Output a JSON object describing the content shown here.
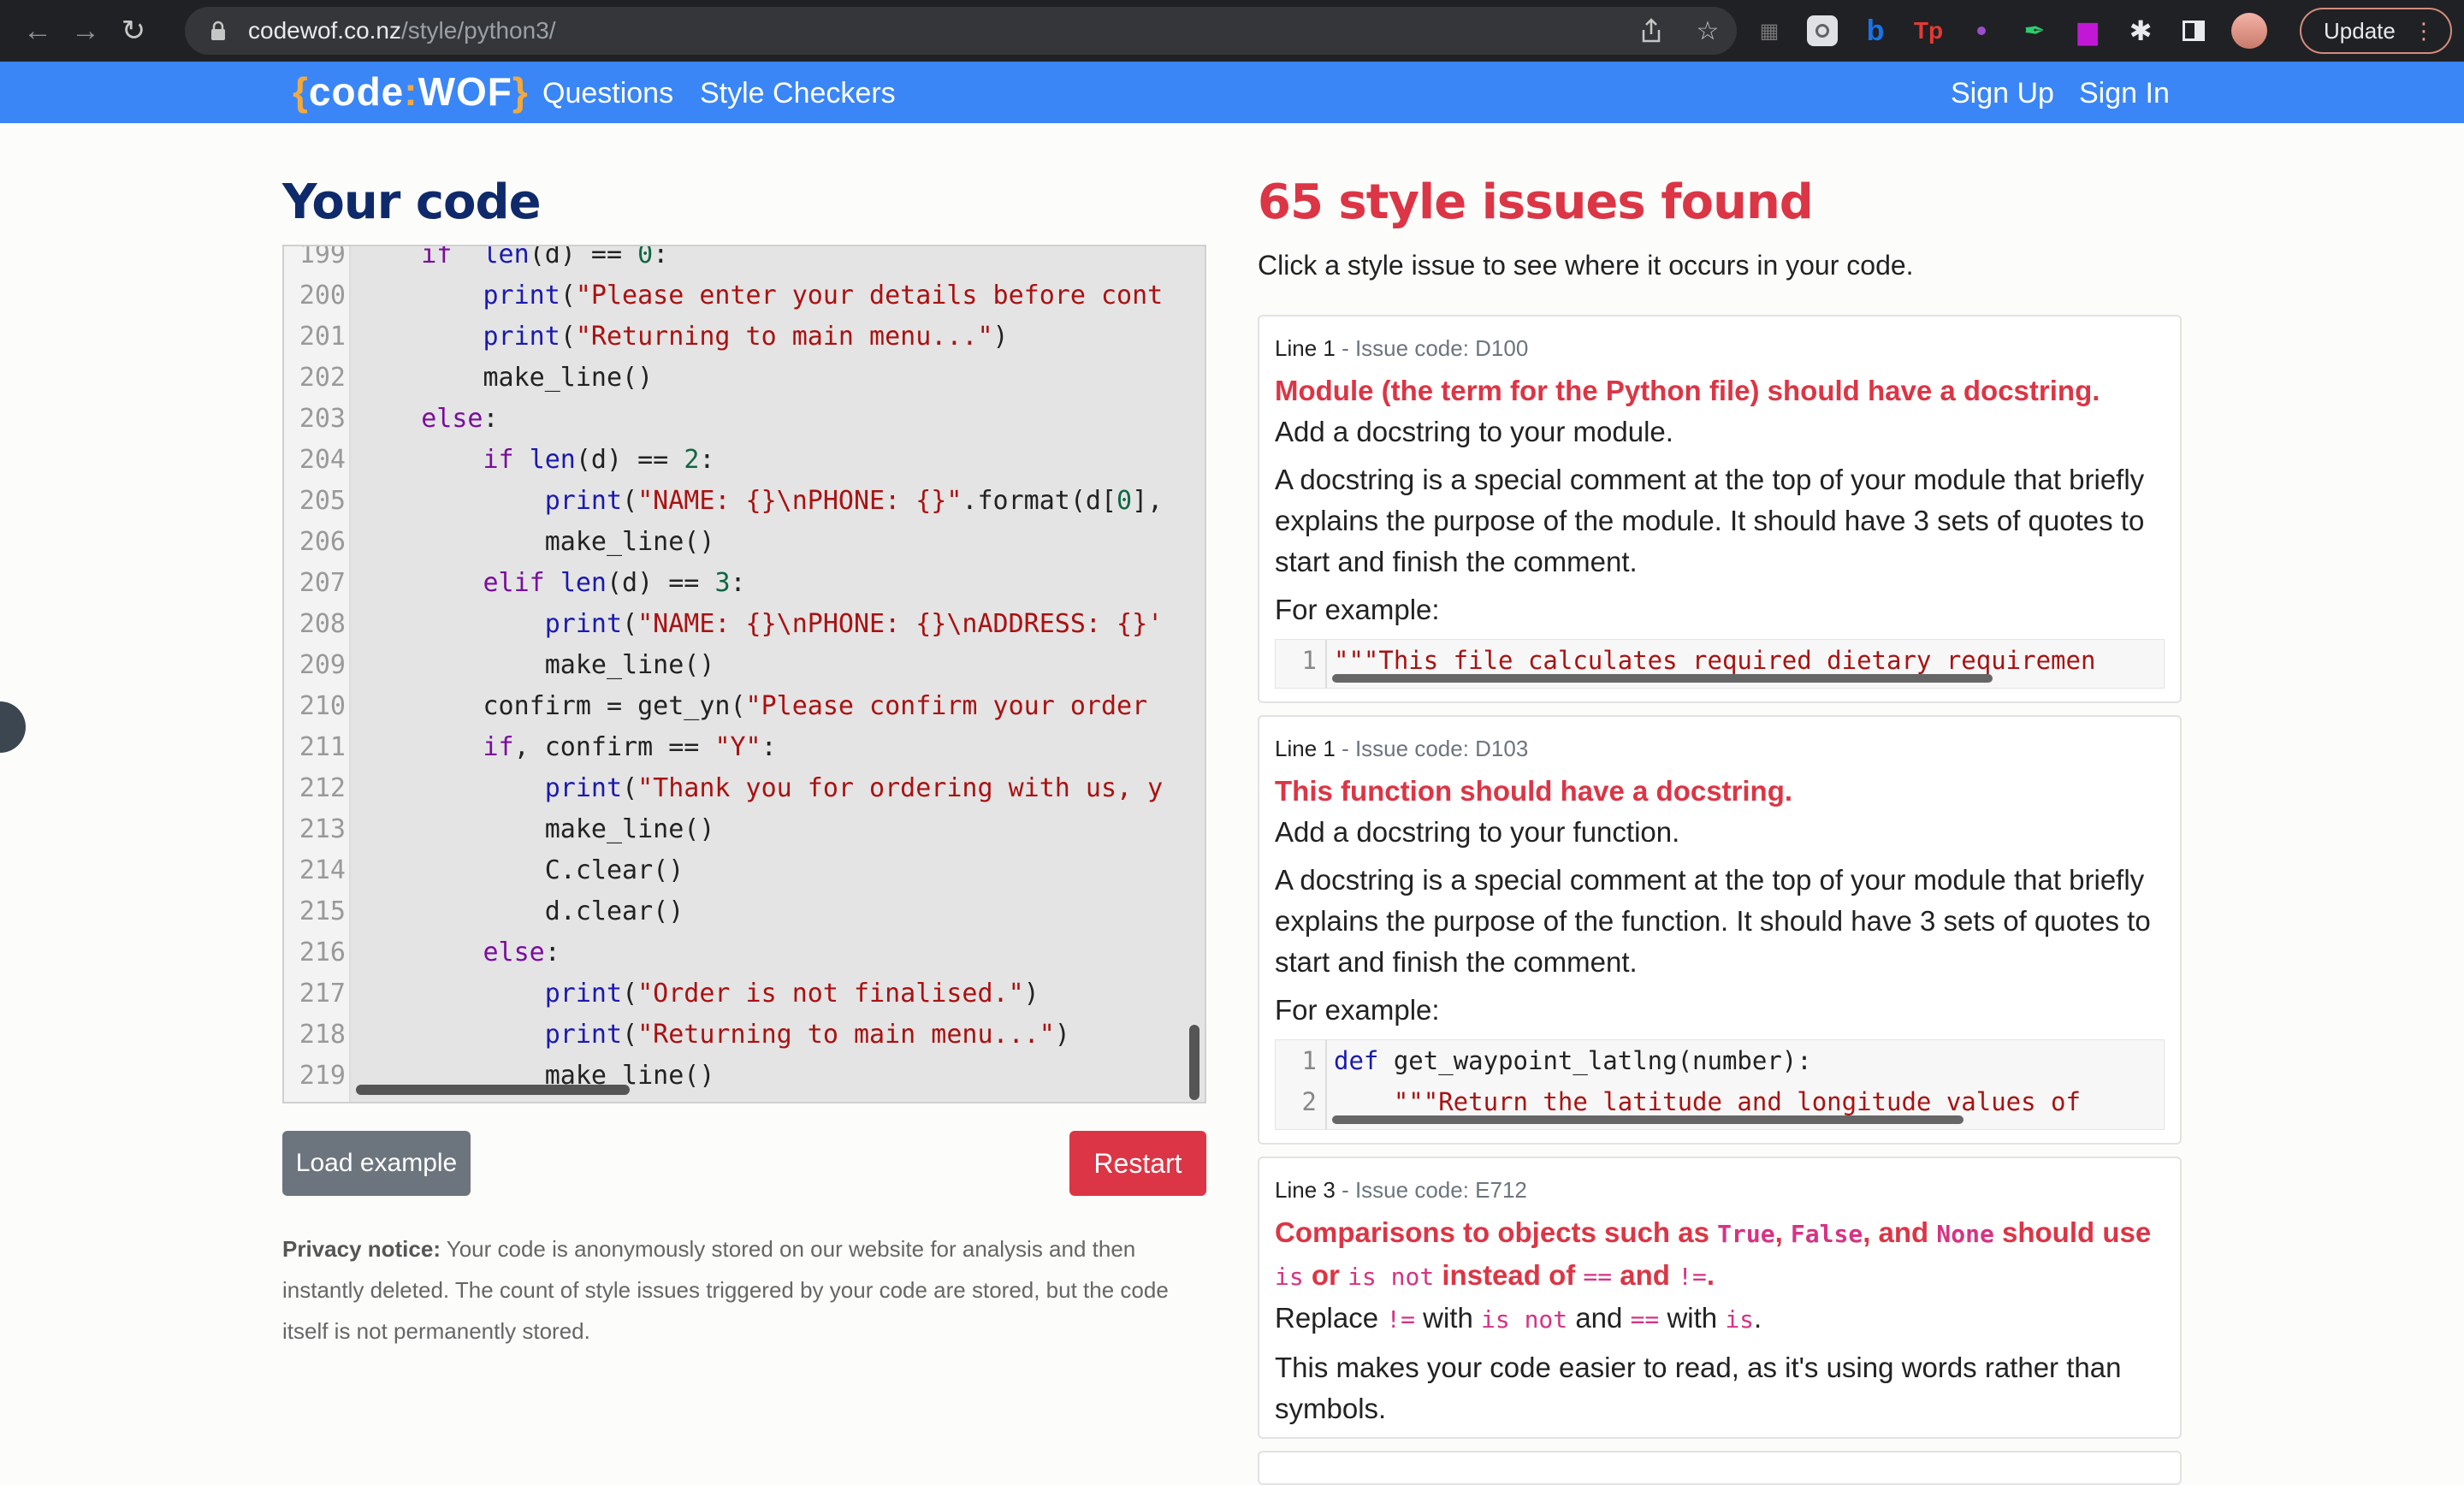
{
  "browser": {
    "url_host": "codewof.co.nz",
    "url_path": "/style/python3/",
    "update_label": "Update"
  },
  "nav": {
    "logo_open": "{",
    "logo_code": "code",
    "logo_colon": ":",
    "logo_wof": "WOF",
    "logo_close": "}",
    "questions": "Questions",
    "style_checkers": "Style Checkers",
    "sign_up": "Sign Up",
    "sign_in": "Sign In"
  },
  "left": {
    "heading": "Your code",
    "load_example": "Load example",
    "restart": "Restart",
    "privacy_label": "Privacy notice:",
    "privacy_text": " Your code is anonymously stored on our website for analysis and then instantly deleted. The count of style issues triggered by your code are stored, but the code itself is not permanently stored."
  },
  "editor": {
    "lines": [
      {
        "n": "199",
        "indent": "    ",
        "parts": [
          [
            "kw",
            "if"
          ],
          [
            "",
            "  "
          ],
          [
            "bi",
            "len"
          ],
          [
            "",
            "(d) == "
          ],
          [
            "num",
            "0"
          ],
          [
            "",
            ":"
          ]
        ]
      },
      {
        "n": "200",
        "indent": "        ",
        "parts": [
          [
            "bi",
            "print"
          ],
          [
            "",
            "("
          ],
          [
            "str",
            "\"Please enter your details before cont"
          ]
        ]
      },
      {
        "n": "201",
        "indent": "        ",
        "parts": [
          [
            "bi",
            "print"
          ],
          [
            "",
            "("
          ],
          [
            "str",
            "\"Returning to main menu...\""
          ],
          [
            "",
            ")"
          ]
        ]
      },
      {
        "n": "202",
        "indent": "        ",
        "parts": [
          [
            "",
            "make_line()"
          ]
        ]
      },
      {
        "n": "203",
        "indent": "    ",
        "parts": [
          [
            "kw",
            "else"
          ],
          [
            "",
            ":"
          ]
        ]
      },
      {
        "n": "204",
        "indent": "        ",
        "parts": [
          [
            "kw",
            "if"
          ],
          [
            "",
            " "
          ],
          [
            "bi",
            "len"
          ],
          [
            "",
            "(d) == "
          ],
          [
            "num",
            "2"
          ],
          [
            "",
            ":"
          ]
        ]
      },
      {
        "n": "205",
        "indent": "            ",
        "parts": [
          [
            "bi",
            "print"
          ],
          [
            "",
            "("
          ],
          [
            "str",
            "\"NAME: {}\\nPHONE: {}\""
          ],
          [
            "",
            ".format(d["
          ],
          [
            "num",
            "0"
          ],
          [
            "",
            "],"
          ]
        ]
      },
      {
        "n": "206",
        "indent": "            ",
        "parts": [
          [
            "",
            "make_line()"
          ]
        ]
      },
      {
        "n": "207",
        "indent": "        ",
        "parts": [
          [
            "kw",
            "elif"
          ],
          [
            "",
            " "
          ],
          [
            "bi",
            "len"
          ],
          [
            "",
            "(d) == "
          ],
          [
            "num",
            "3"
          ],
          [
            "",
            ":"
          ]
        ]
      },
      {
        "n": "208",
        "indent": "            ",
        "parts": [
          [
            "bi",
            "print"
          ],
          [
            "",
            "("
          ],
          [
            "str",
            "\"NAME: {}\\nPHONE: {}\\nADDRESS: {}'"
          ]
        ]
      },
      {
        "n": "209",
        "indent": "            ",
        "parts": [
          [
            "",
            "make_line()"
          ]
        ]
      },
      {
        "n": "210",
        "indent": "        ",
        "parts": [
          [
            "",
            "confirm = get_yn("
          ],
          [
            "str",
            "\"Please confirm your order"
          ]
        ]
      },
      {
        "n": "211",
        "indent": "        ",
        "parts": [
          [
            "kw",
            "if"
          ],
          [
            "",
            ", confirm == "
          ],
          [
            "str",
            "\"Y\""
          ],
          [
            "",
            ":"
          ]
        ]
      },
      {
        "n": "212",
        "indent": "            ",
        "parts": [
          [
            "bi",
            "print"
          ],
          [
            "",
            "("
          ],
          [
            "str",
            "\"Thank you for ordering with us, y"
          ]
        ]
      },
      {
        "n": "213",
        "indent": "            ",
        "parts": [
          [
            "",
            "make_line()"
          ]
        ]
      },
      {
        "n": "214",
        "indent": "            ",
        "parts": [
          [
            "",
            "C.clear()"
          ]
        ]
      },
      {
        "n": "215",
        "indent": "            ",
        "parts": [
          [
            "",
            "d.clear()"
          ]
        ]
      },
      {
        "n": "216",
        "indent": "        ",
        "parts": [
          [
            "kw",
            "else"
          ],
          [
            "",
            ":"
          ]
        ]
      },
      {
        "n": "217",
        "indent": "            ",
        "parts": [
          [
            "bi",
            "print"
          ],
          [
            "",
            "("
          ],
          [
            "str",
            "\"Order is not finalised.\""
          ],
          [
            "",
            ")"
          ]
        ]
      },
      {
        "n": "218",
        "indent": "            ",
        "parts": [
          [
            "bi",
            "print"
          ],
          [
            "",
            "("
          ],
          [
            "str",
            "\"Returning to main menu...\""
          ],
          [
            "",
            ")"
          ]
        ]
      },
      {
        "n": "219",
        "indent": "            ",
        "parts": [
          [
            "",
            "make_line()"
          ]
        ]
      }
    ]
  },
  "right": {
    "heading": "65 style issues found",
    "subtext": "Click a style issue to see where it occurs in your code."
  },
  "issues": [
    {
      "line_label": "Line 1",
      "issue_code": " - Issue code: D100",
      "title": "Module (the term for the Python file) should have a docstring.",
      "fix": "Add a docstring to your module.",
      "explanation": "A docstring is a special comment at the top of your module that briefly explains the purpose of the module. It should have 3 sets of quotes to start and finish the comment.",
      "example_label": "For example:",
      "snippet": [
        {
          "n": "1",
          "code": "\"\"\"This file calculates required dietary requiremen"
        }
      ]
    },
    {
      "line_label": "Line 1",
      "issue_code": " - Issue code: D103",
      "title": "This function should have a docstring.",
      "fix": "Add a docstring to your function.",
      "explanation": "A docstring is a special comment at the top of your module that briefly explains the purpose of the function. It should have 3 sets of quotes to start and finish the comment.",
      "example_label": "For example:",
      "snippet": [
        {
          "n": "1",
          "kw": "def",
          "code": " get_waypoint_latlng(number):"
        },
        {
          "n": "2",
          "code": "    \"\"\"Return the latitude and longitude values of"
        }
      ]
    },
    {
      "line_label": "Line 3",
      "issue_code": " - Issue code: E712",
      "title_a": "Comparisons to objects such as ",
      "t_true": "True",
      "t_comma1": ", ",
      "t_false": "False",
      "t_and": ", and ",
      "t_none": "None",
      "t_should": " should use",
      "t_is": "is",
      "t_or": " or ",
      "t_isnot": "is not",
      "t_instead": " instead of ",
      "t_eq": "==",
      "t_and2": " and ",
      "t_ne": "!=",
      "t_dot": ".",
      "fix_replace": "Replace ",
      "fix_ne": "!=",
      "fix_with1": " with ",
      "fix_isnot": "is not",
      "fix_and": " and ",
      "fix_eq": "==",
      "fix_with2": " with ",
      "fix_is": "is",
      "fix_dot": ".",
      "explanation": "This makes your code easier to read, as it's using words rather than symbols."
    }
  ]
}
